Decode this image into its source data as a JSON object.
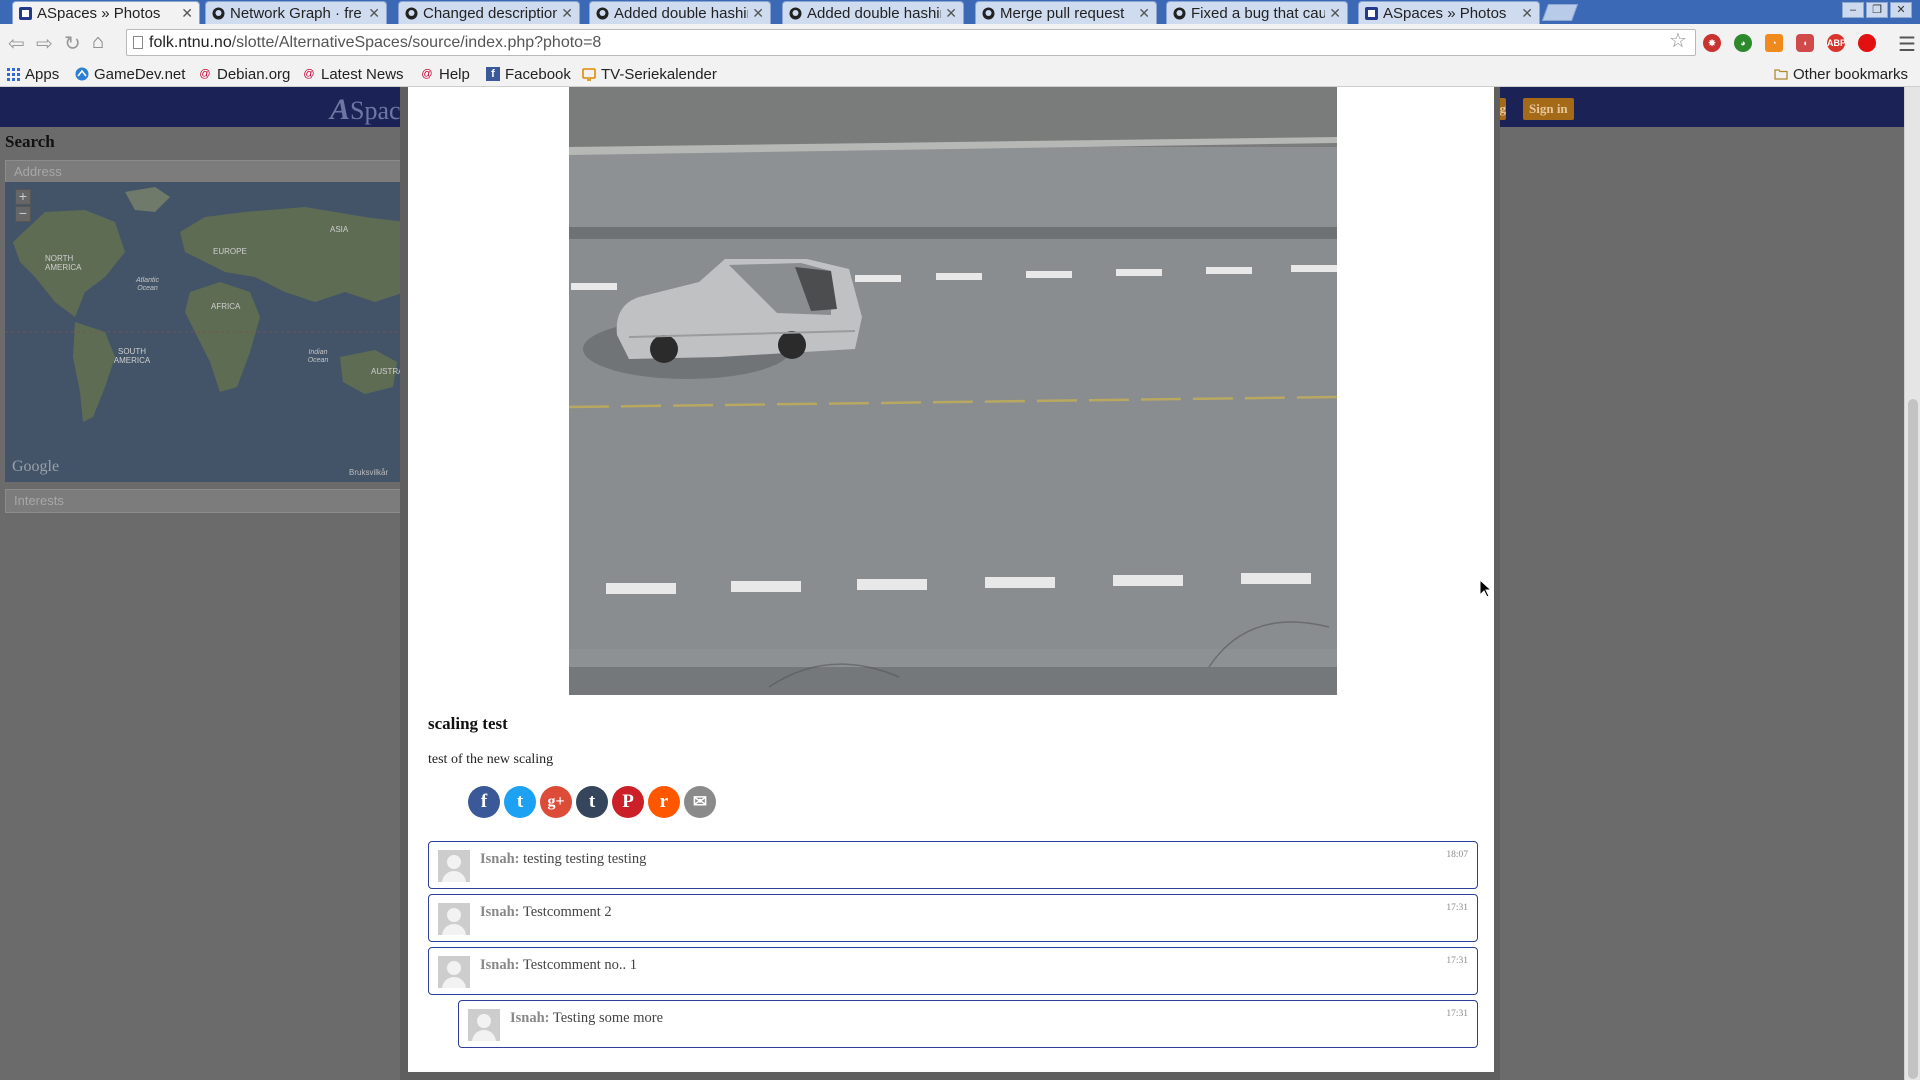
{
  "browser": {
    "tabs": [
      {
        "title": "ASpaces » Photos",
        "icon": "aspaces-icon",
        "active": true
      },
      {
        "title": "Network Graph · fre",
        "icon": "github-icon",
        "active": false
      },
      {
        "title": "Changed description",
        "icon": "github-icon",
        "active": false
      },
      {
        "title": "Added double hashir",
        "icon": "github-icon",
        "active": false
      },
      {
        "title": "Added double hashir",
        "icon": "github-icon",
        "active": false
      },
      {
        "title": "Merge pull request",
        "icon": "github-icon",
        "active": false
      },
      {
        "title": "Fixed a bug that caus",
        "icon": "github-icon",
        "active": false
      },
      {
        "title": "ASpaces » Photos",
        "icon": "aspaces-icon",
        "active": false
      }
    ],
    "url_host": "folk.ntnu.no",
    "url_path": "/slotte/AlternativeSpaces/source/index.php?photo=8",
    "bookmarks": [
      {
        "label": "Apps",
        "icon": "apps-grid-icon"
      },
      {
        "label": "GameDev.net",
        "icon": "gamedev-icon"
      },
      {
        "label": "Debian.org",
        "icon": "debian-icon"
      },
      {
        "label": "Latest News",
        "icon": "debian-icon"
      },
      {
        "label": "Help",
        "icon": "debian-icon"
      },
      {
        "label": "Facebook",
        "icon": "facebook-icon"
      },
      {
        "label": "TV-Seriekalender",
        "icon": "tv-icon"
      }
    ],
    "other_bookmarks": "Other bookmarks",
    "extension_icons": [
      "gear-extension-icon",
      "green-extension-icon",
      "rss-icon",
      "pocket-icon",
      "adblock-plus-icon",
      "red-dot-icon"
    ],
    "extension_badges": {
      "adblock": "ABP"
    }
  },
  "site": {
    "logo_initial": "A",
    "logo_rest": "Spac",
    "header_button_partial": "g",
    "sign_in": "Sign in",
    "search_heading": "Search",
    "address_placeholder": "Address",
    "interests_placeholder": "Interests",
    "map": {
      "attribution": "Google",
      "terms": "Bruksvilkår",
      "zoom_in": "+",
      "zoom_out": "−",
      "labels": {
        "north_america": "NORTH AMERICA",
        "europe": "EUROPE",
        "asia": "ASIA",
        "africa": "AFRICA",
        "south_america": "SOUTH AMERICA",
        "australia": "AUSTRA",
        "atlantic": "Atlantic Ocean",
        "indian": "Indian Ocean"
      }
    }
  },
  "photo": {
    "title": "scaling test",
    "description": "test of the new scaling"
  },
  "share": [
    {
      "name": "facebook",
      "glyph": "f",
      "color": "#3b5998"
    },
    {
      "name": "twitter",
      "glyph": "t",
      "color": "#1da1f2"
    },
    {
      "name": "google-plus",
      "glyph": "g+",
      "color": "#dd4b39"
    },
    {
      "name": "tumblr",
      "glyph": "t",
      "color": "#35465c"
    },
    {
      "name": "pinterest",
      "glyph": "P",
      "color": "#cb2027"
    },
    {
      "name": "reddit",
      "glyph": "r",
      "color": "#ff5700"
    },
    {
      "name": "email",
      "glyph": "✉",
      "color": "#8a8a8a"
    }
  ],
  "comments": [
    {
      "author": "Isnah:",
      "text": "testing testing testing",
      "time": "18:07",
      "reply": false
    },
    {
      "author": "Isnah:",
      "text": "Testcomment 2",
      "time": "17:31",
      "reply": false
    },
    {
      "author": "Isnah:",
      "text": "Testcomment no.. 1",
      "time": "17:31",
      "reply": false
    },
    {
      "author": "Isnah:",
      "text": "Testing some more",
      "time": "17:31",
      "reply": true
    }
  ],
  "colors": {
    "header_navy": "#1b2256",
    "comment_border": "#2c3f9a",
    "sign_in_button": "#a56a17"
  }
}
